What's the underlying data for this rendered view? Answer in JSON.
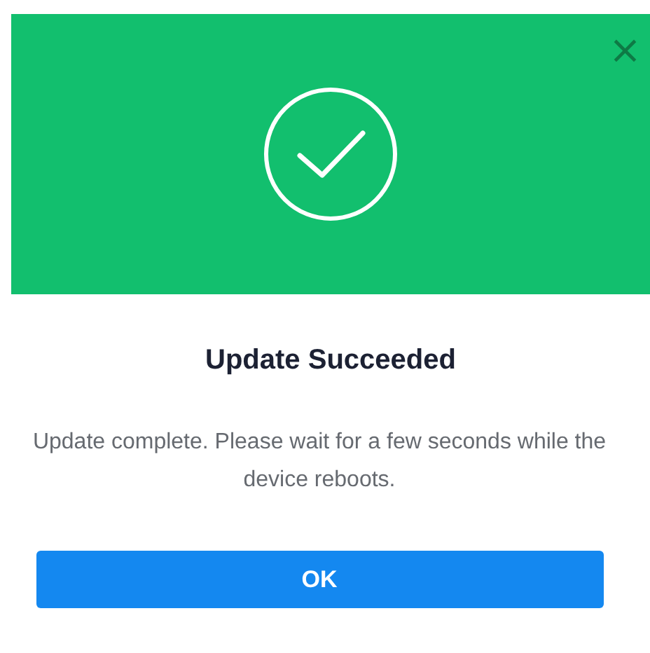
{
  "header": {
    "close_glyph": "×"
  },
  "title": "Update Succeeded",
  "message": "Update complete. Please wait for a few seconds while the device reboots.",
  "buttons": [
    "OK"
  ]
}
